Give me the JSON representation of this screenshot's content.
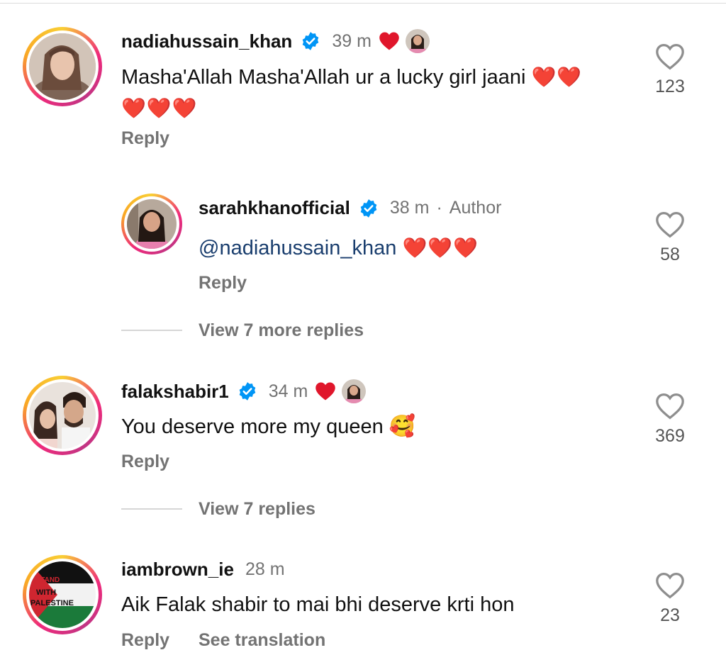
{
  "comments": [
    {
      "username": "nadiahussain_khan",
      "time": "39 m",
      "text_line1": "Masha'Allah  Masha'Allah ur a lucky girl jaani",
      "reply": "Reply",
      "likes": "123",
      "liked_by_author": true
    },
    {
      "username": "sarahkhanofficial",
      "time": "38 m",
      "author_tag": "Author",
      "mention": "@nadiahussain_khan",
      "reply": "Reply",
      "likes": "58",
      "view_more": "View 7 more replies"
    },
    {
      "username": "falakshabir1",
      "time": "34 m",
      "text": "You deserve more my queen",
      "reply": "Reply",
      "likes": "369",
      "liked_by_author": true,
      "view_more": "View 7 replies"
    },
    {
      "username": "iambrown_ie",
      "time": "28 m",
      "text": "Aik Falak shabir to mai bhi deserve krti hon",
      "reply": "Reply",
      "see_translation": "See translation",
      "likes": "23",
      "avatar_text": [
        "I STAND",
        "WITH",
        "PALESTINE"
      ]
    }
  ],
  "colors": {
    "accent_heart": "#e0162b",
    "verified": "#0095f6",
    "muted": "#737373"
  }
}
